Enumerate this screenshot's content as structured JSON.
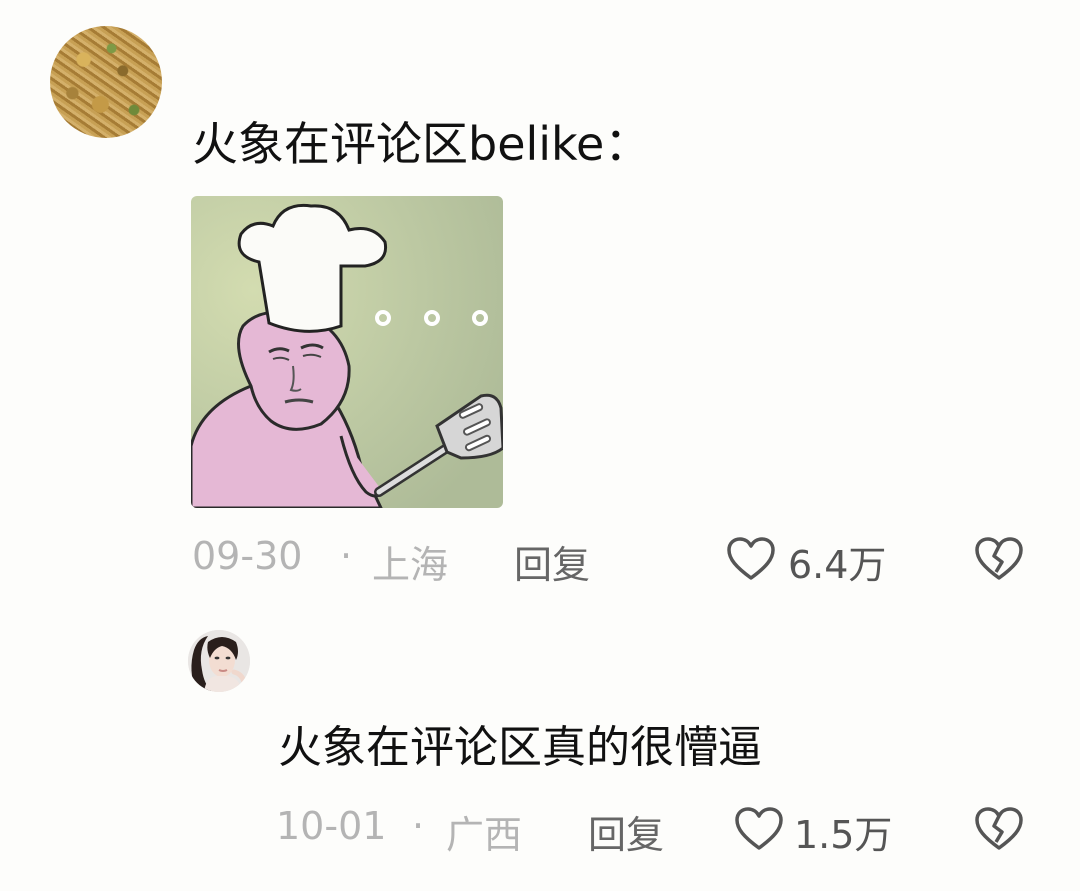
{
  "comments": [
    {
      "avatar": "food-avatar",
      "text": "火象在评论区belike：",
      "date": "09-30",
      "separator": "·",
      "location": "上海",
      "reply_label": "回复",
      "likes": "6.4万",
      "has_image": true,
      "image": "chef-meme-sticker"
    },
    {
      "avatar": "woman-portrait-avatar",
      "text": "火象在评论区真的很懵逼",
      "date": "10-01",
      "separator": "·",
      "location": "广西",
      "reply_label": "回复",
      "likes": "1.5万"
    }
  ],
  "icons": {
    "like": "heart-outline-icon",
    "dislike": "broken-heart-icon"
  },
  "colors": {
    "text": "#111111",
    "meta": "#b4b4b4",
    "reply": "#666666",
    "background": "#fdfdfb"
  }
}
